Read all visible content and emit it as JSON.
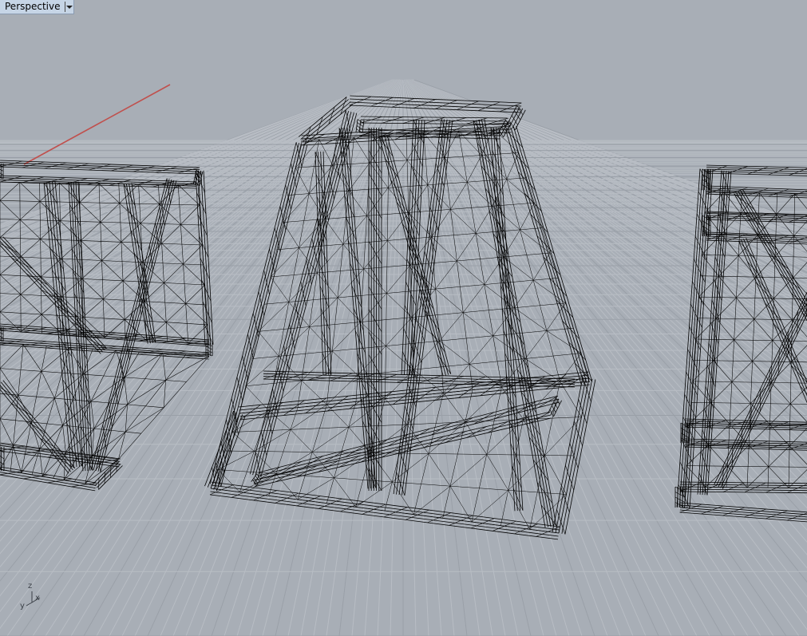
{
  "viewport": {
    "name": "Perspective",
    "menu_icon": "chevron-down-icon"
  },
  "axes": {
    "x": "x",
    "y": "y",
    "z": "z"
  },
  "colors": {
    "background": "#a8aeb6",
    "grid_minor": "#b8bdc4",
    "grid_major": "#9aa0a8",
    "x_axis": "#c0504d",
    "wire": "#000000",
    "tab_background": "#c6d5e6"
  }
}
